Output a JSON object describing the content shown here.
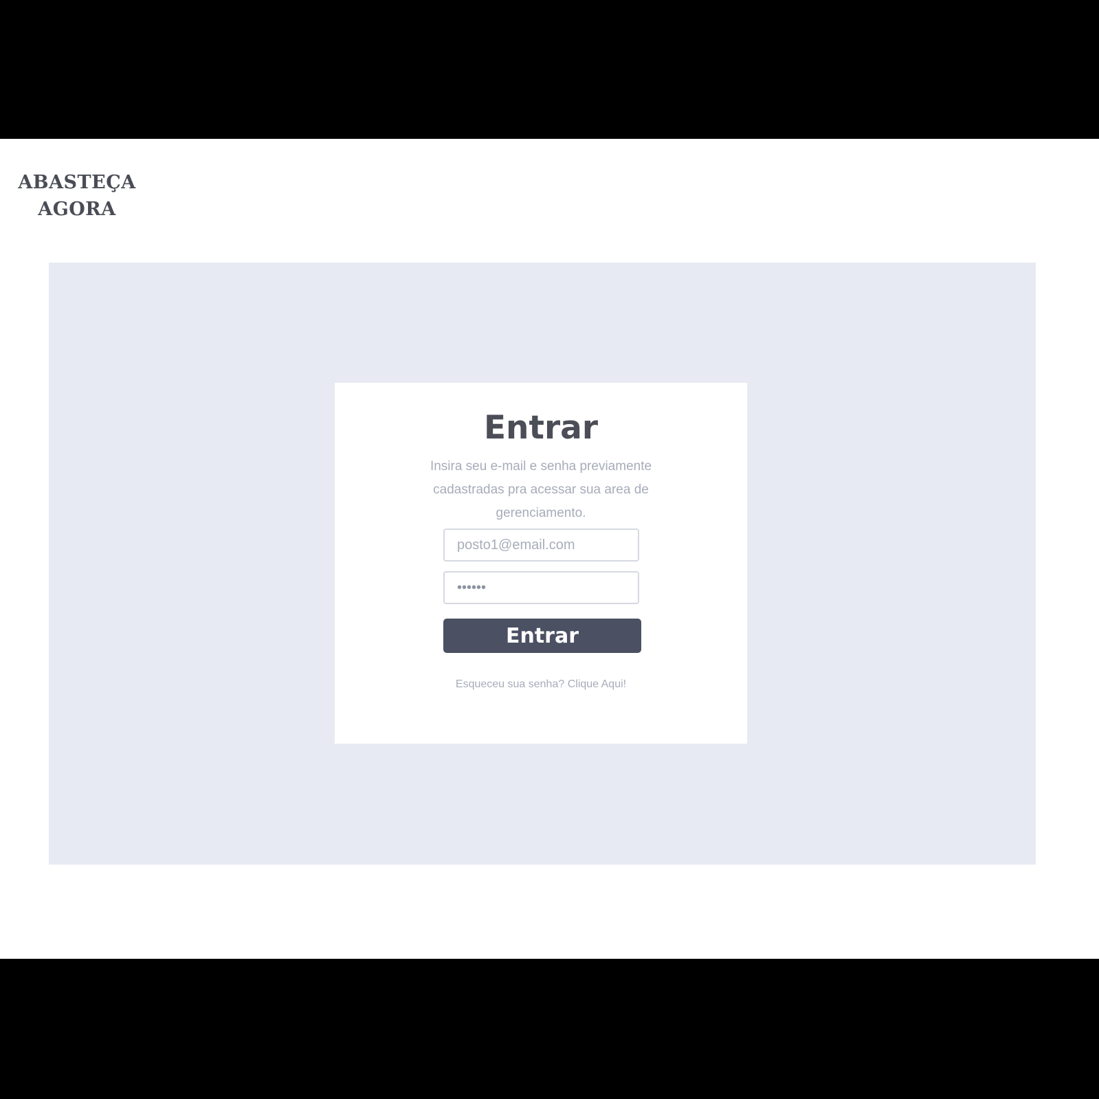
{
  "brand": {
    "line1": "ABASTEÇA",
    "line2": "AGORA"
  },
  "login": {
    "title": "Entrar",
    "description": "Insira seu e-mail e senha previamente cadastradas pra acessar sua area de gerenciamento.",
    "email_placeholder": "posto1@email.com",
    "password_value": "******",
    "submit_label": "Entrar",
    "forgot_text": "Esqueceu sua senha?",
    "forgot_link": "Clique Aqui!"
  },
  "colors": {
    "background_outer": "#000000",
    "frame": "#ffffff",
    "stage": "#e8eaf3",
    "button": "#4b5163",
    "text_dark": "#4b4d57",
    "text_muted": "#a7acb9"
  }
}
